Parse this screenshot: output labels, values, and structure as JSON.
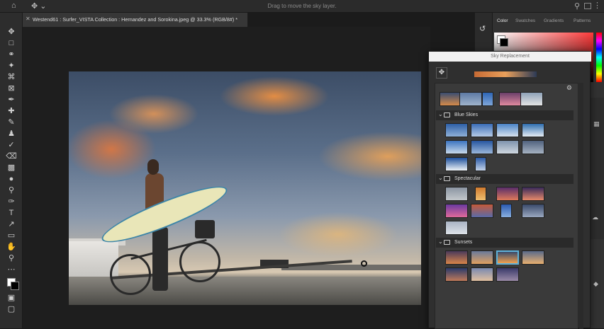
{
  "menubar": {
    "tip": "Drag to move the sky layer."
  },
  "document": {
    "tab_title": "Westend61 : Surfer_VISTA Collection : Hernandez and Sorokina.jpeg @ 33.3% (RGB/8#) *"
  },
  "panel_tabs": [
    "Color",
    "Swatches",
    "Gradients",
    "Patterns"
  ],
  "dialog": {
    "title": "Sky Replacement"
  },
  "sections": [
    {
      "name": "Blue Skies"
    },
    {
      "name": "Spectacular"
    },
    {
      "name": "Sunsets"
    }
  ],
  "colors": {
    "accent_selection": "#5fb2d9",
    "dialog_title_bg": "#f2f2f2"
  }
}
